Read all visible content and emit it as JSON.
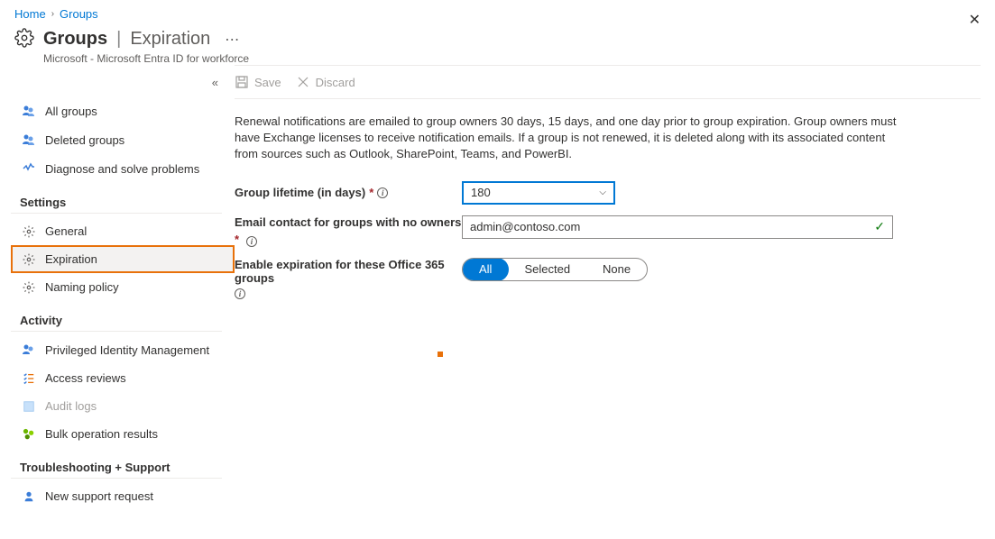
{
  "breadcrumb": {
    "home": "Home",
    "groups": "Groups"
  },
  "header": {
    "title": "Groups",
    "subtitle": "Expiration",
    "provider": "Microsoft - Microsoft Entra ID for workforce"
  },
  "toolbar": {
    "save": "Save",
    "discard": "Discard"
  },
  "sidebar": {
    "collapse": "«",
    "top": [
      {
        "label": "All groups"
      },
      {
        "label": "Deleted groups"
      },
      {
        "label": "Diagnose and solve problems"
      }
    ],
    "settings_head": "Settings",
    "settings": [
      {
        "label": "General"
      },
      {
        "label": "Expiration"
      },
      {
        "label": "Naming policy"
      }
    ],
    "activity_head": "Activity",
    "activity": [
      {
        "label": "Privileged Identity Management"
      },
      {
        "label": "Access reviews"
      },
      {
        "label": "Audit logs"
      },
      {
        "label": "Bulk operation results"
      }
    ],
    "trouble_head": "Troubleshooting + Support",
    "trouble": [
      {
        "label": "New support request"
      }
    ]
  },
  "main": {
    "description": "Renewal notifications are emailed to group owners 30 days, 15 days, and one day prior to group expiration. Group owners must have Exchange licenses to receive notification emails. If a group is not renewed, it is deleted along with its associated content from sources such as Outlook, SharePoint, Teams, and PowerBI.",
    "lifetime_label": "Group lifetime (in days)",
    "lifetime_value": "180",
    "email_label": "Email contact for groups with no owners",
    "email_value": "admin@contoso.com",
    "enable_label": "Enable expiration for these Office 365 groups",
    "toggle": {
      "all": "All",
      "selected": "Selected",
      "none": "None"
    }
  }
}
